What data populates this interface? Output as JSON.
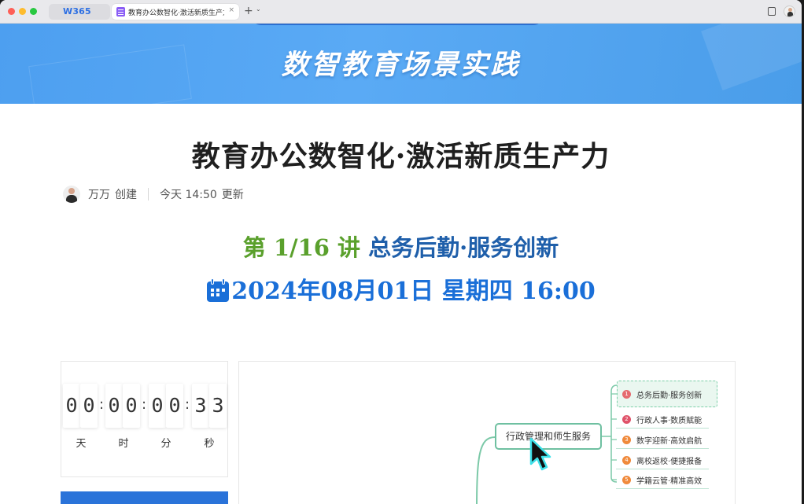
{
  "browser": {
    "tabs": [
      {
        "label": "W365"
      },
      {
        "label": "教育办公数智化·激活新质生产力"
      }
    ],
    "close_glyph": "×",
    "new_tab_glyph": "+",
    "chevron_glyph": "⌄"
  },
  "banner": {
    "title": "数智教育场景实践"
  },
  "doc": {
    "title": "教育办公数智化·激活新质生产力",
    "author": "万万",
    "author_action": "创建",
    "updated_time": "今天 14:50",
    "updated_action": "更新"
  },
  "lecture": {
    "prefix": "第 1/16 讲",
    "topic": "总务后勤·服务创新",
    "datetime": "2024年08月01日 星期四 16:00"
  },
  "countdown": {
    "digits": [
      "0",
      "0",
      "0",
      "0",
      "0",
      "0",
      "3",
      "3"
    ],
    "units": [
      "天",
      "时",
      "分",
      "秒"
    ],
    "separator": ":"
  },
  "mindmap": {
    "root_label": "行政管理和师生服务",
    "items": [
      {
        "num": "1",
        "label": "总务后勤·服务创新",
        "color": "#e56b6f"
      },
      {
        "num": "2",
        "label": "行政人事·数质赋能",
        "color": "#e0546a"
      },
      {
        "num": "3",
        "label": "数字迎新·高效启航",
        "color": "#f08a3c"
      },
      {
        "num": "4",
        "label": "离校返校·便捷报备",
        "color": "#f08a3c"
      },
      {
        "num": "5",
        "label": "学籍云管·精准高效",
        "color": "#f08a3c"
      }
    ],
    "line_color": "#7cc9a8"
  },
  "colors": {
    "banner": "#4d9ff0",
    "lecture_green": "#5aa02c",
    "lecture_blue": "#1f5faa",
    "date_blue": "#1a6fd8"
  }
}
